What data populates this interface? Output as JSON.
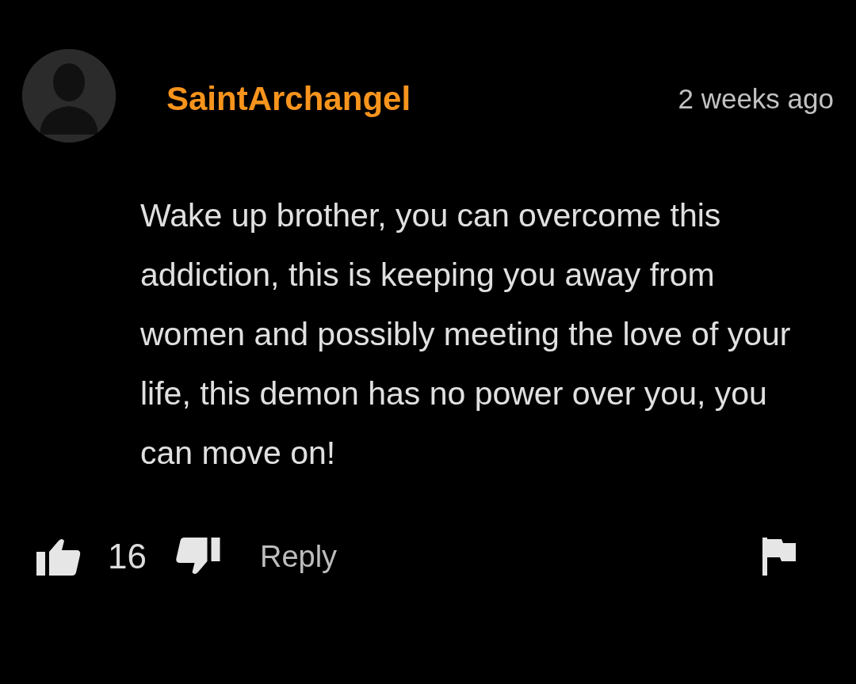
{
  "comment": {
    "username": "SaintArchangel",
    "time": "2 weeks ago",
    "text": "Wake up brother, you can overcome this addiction, this is keeping you away from women and possibly meeting the love of your life, this demon has no power over you, you can move on!",
    "likes": "16",
    "reply": "Reply"
  }
}
